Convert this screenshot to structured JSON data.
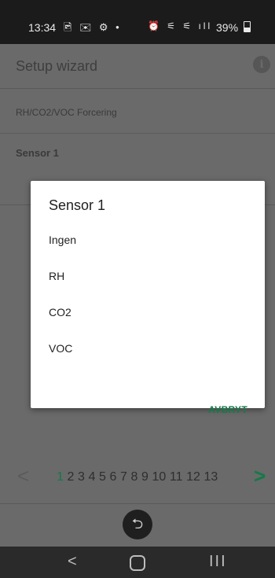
{
  "status_bar": {
    "time": "13:34",
    "left_icons": "🖻 ✉ ⚙ •",
    "right_icons": "⏰ ⚟ ⚟ ıll",
    "battery": "39%"
  },
  "app": {
    "title": "Setup wizard",
    "info_icon": "i",
    "section_heading": "RH/CO2/VOC Forcering",
    "sensor_label": "Sensor 1"
  },
  "dialog": {
    "title": "Sensor 1",
    "options": [
      "Ingen",
      "RH",
      "CO2",
      "VOC"
    ],
    "cancel_label": "AVBRYT",
    "accent_color": "#137a48"
  },
  "pager": {
    "prev": "<",
    "next": ">",
    "pages": [
      "1",
      "2",
      "3",
      "4",
      "5",
      "6",
      "7",
      "8",
      "9",
      "10",
      "11",
      "12",
      "13"
    ],
    "active_page": "1"
  },
  "nav_bar": {
    "back": "<",
    "recent": "III"
  }
}
